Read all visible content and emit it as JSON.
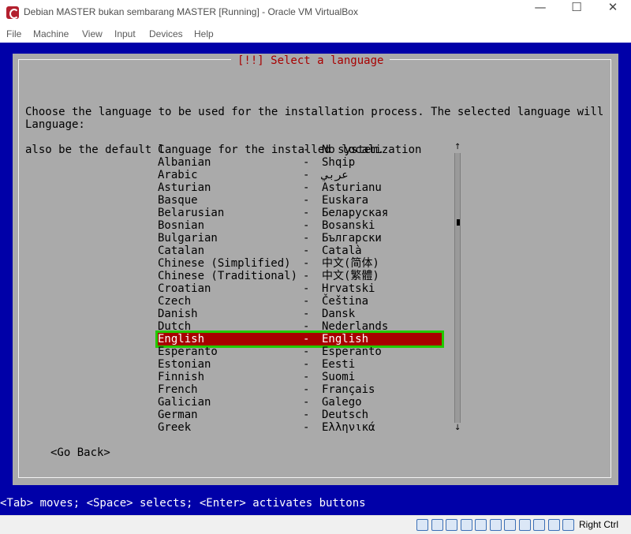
{
  "window": {
    "title": "Debian MASTER bukan sembarang MASTER [Running] - Oracle VM VirtualBox",
    "minimize_glyph": "—",
    "maximize_glyph": "☐",
    "close_glyph": "✕"
  },
  "menu": [
    "File",
    "Machine",
    "View",
    "Input",
    "Devices",
    "Help"
  ],
  "installer": {
    "title": "[!!] Select a language",
    "description_line1": "Choose the language to be used for the installation process. The selected language will",
    "description_line2": "also be the default language for the installed system.",
    "language_label": "Language:",
    "separator": "-",
    "languages": [
      {
        "name": "C",
        "native": "No localization"
      },
      {
        "name": "Albanian",
        "native": "Shqip"
      },
      {
        "name": "Arabic",
        "native": "عربي"
      },
      {
        "name": "Asturian",
        "native": "Asturianu"
      },
      {
        "name": "Basque",
        "native": "Euskara"
      },
      {
        "name": "Belarusian",
        "native": "Беларуская"
      },
      {
        "name": "Bosnian",
        "native": "Bosanski"
      },
      {
        "name": "Bulgarian",
        "native": "Български"
      },
      {
        "name": "Catalan",
        "native": "Català"
      },
      {
        "name": "Chinese (Simplified)",
        "native": "中文(简体)"
      },
      {
        "name": "Chinese (Traditional)",
        "native": "中文(繁體)"
      },
      {
        "name": "Croatian",
        "native": "Hrvatski"
      },
      {
        "name": "Czech",
        "native": "Čeština"
      },
      {
        "name": "Danish",
        "native": "Dansk"
      },
      {
        "name": "Dutch",
        "native": "Nederlands"
      },
      {
        "name": "English",
        "native": "English",
        "selected": true
      },
      {
        "name": "Esperanto",
        "native": "Esperanto"
      },
      {
        "name": "Estonian",
        "native": "Eesti"
      },
      {
        "name": "Finnish",
        "native": "Suomi"
      },
      {
        "name": "French",
        "native": "Français"
      },
      {
        "name": "Galician",
        "native": "Galego"
      },
      {
        "name": "German",
        "native": "Deutsch"
      },
      {
        "name": "Greek",
        "native": "Ελληνικά"
      }
    ],
    "scroll_up_glyph": "↑",
    "scroll_down_glyph": "↓",
    "go_back_label": "<Go Back>",
    "key_hints": "<Tab> moves; <Space> selects; <Enter> activates buttons"
  },
  "statusbar": {
    "icons": [
      "hard-disk-icon",
      "optical-drive-icon",
      "audio-icon",
      "network-icon",
      "usb-icon",
      "shared-folder-icon",
      "display-icon",
      "video-capture-icon",
      "cpu-icon",
      "mouse-integration-icon",
      "keyboard-icon"
    ],
    "host_key_label": "Right Ctrl"
  },
  "colors": {
    "vm_background": "#0000a8",
    "dialog_background": "#aaaaaa",
    "title_red": "#a80000",
    "selection_red": "#a80000",
    "selection_outline": "#22c900"
  }
}
